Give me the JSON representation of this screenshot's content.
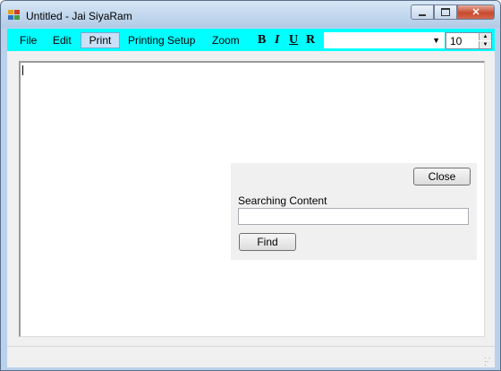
{
  "window": {
    "title": "Untitled - Jai SiyaRam",
    "minimize_icon": "minimize-icon",
    "maximize_icon": "maximize-icon",
    "close_icon": "close-icon"
  },
  "menu": {
    "items": [
      {
        "label": "File",
        "selected": false
      },
      {
        "label": "Edit",
        "selected": false
      },
      {
        "label": "Print",
        "selected": true
      },
      {
        "label": "Printing Setup",
        "selected": false
      },
      {
        "label": "Zoom",
        "selected": false
      }
    ],
    "format_buttons": [
      {
        "label": "B",
        "icon": "bold-icon"
      },
      {
        "label": "I",
        "icon": "italic-icon"
      },
      {
        "label": "U",
        "icon": "underline-icon"
      },
      {
        "label": "R",
        "icon": "regular-icon"
      }
    ],
    "font_select_value": "",
    "font_size_value": "10",
    "background_color": "#00ffff"
  },
  "editor": {
    "content": ""
  },
  "search_panel": {
    "close_label": "Close",
    "label": "Searching Content",
    "input_value": "",
    "find_label": "Find"
  }
}
